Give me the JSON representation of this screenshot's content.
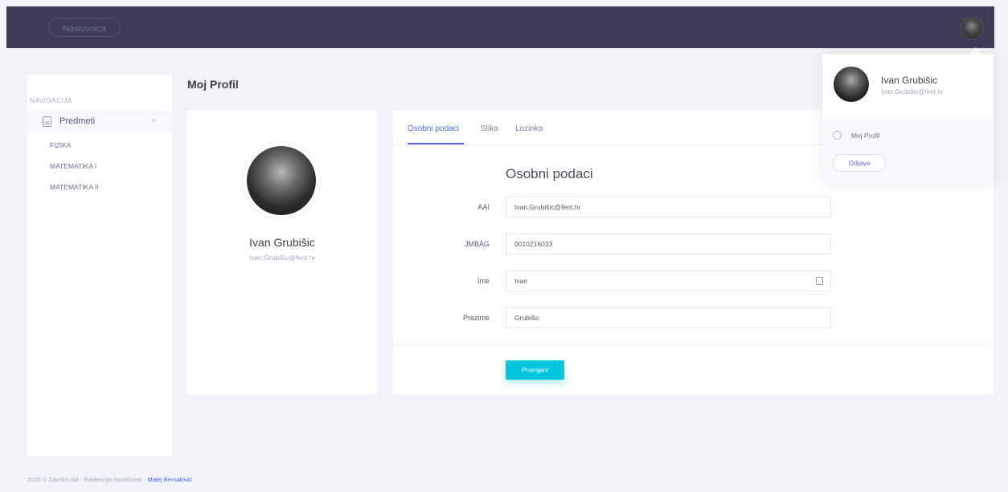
{
  "topbar": {
    "home_label": "Naslovnica"
  },
  "sidebar": {
    "header": "NAVIGACIJA",
    "group": {
      "label": "Predmeti"
    },
    "items": [
      "FIZIKA",
      "MATEMATIKA I",
      "MATEMATIKA II"
    ]
  },
  "page": {
    "title": "Moj Profil"
  },
  "profile": {
    "name": "Ivan Grubišic",
    "email": "Ivan.Grubišic@ferit.hr"
  },
  "tabs": [
    "Osobni podaci",
    "Slika",
    "Lozinka"
  ],
  "form": {
    "title": "Osobni podaci",
    "fields": [
      {
        "label": "AAI",
        "value": "Ivan.Grubišic@ferit.hr"
      },
      {
        "label": "JMBAG",
        "value": "0010216033"
      },
      {
        "label": "Ime",
        "value": "Ivan"
      },
      {
        "label": "Prezime",
        "value": "Grubišic"
      }
    ],
    "submit": "Promjeni"
  },
  "dropdown": {
    "name": "Ivan Grubišic",
    "email": "Ivan.Grubišic@ferit.hr",
    "profile_link": "Moj Profil",
    "logout": "Odjava"
  },
  "footer": {
    "text": "2020 © Završni rad - Evidencija nazočnosti - ",
    "author": "Matej Bernatović"
  },
  "colors": {
    "topbar": "#3e3d55",
    "accent": "#5867dd",
    "button": "#00c5dc",
    "background": "#f2f3f8"
  }
}
